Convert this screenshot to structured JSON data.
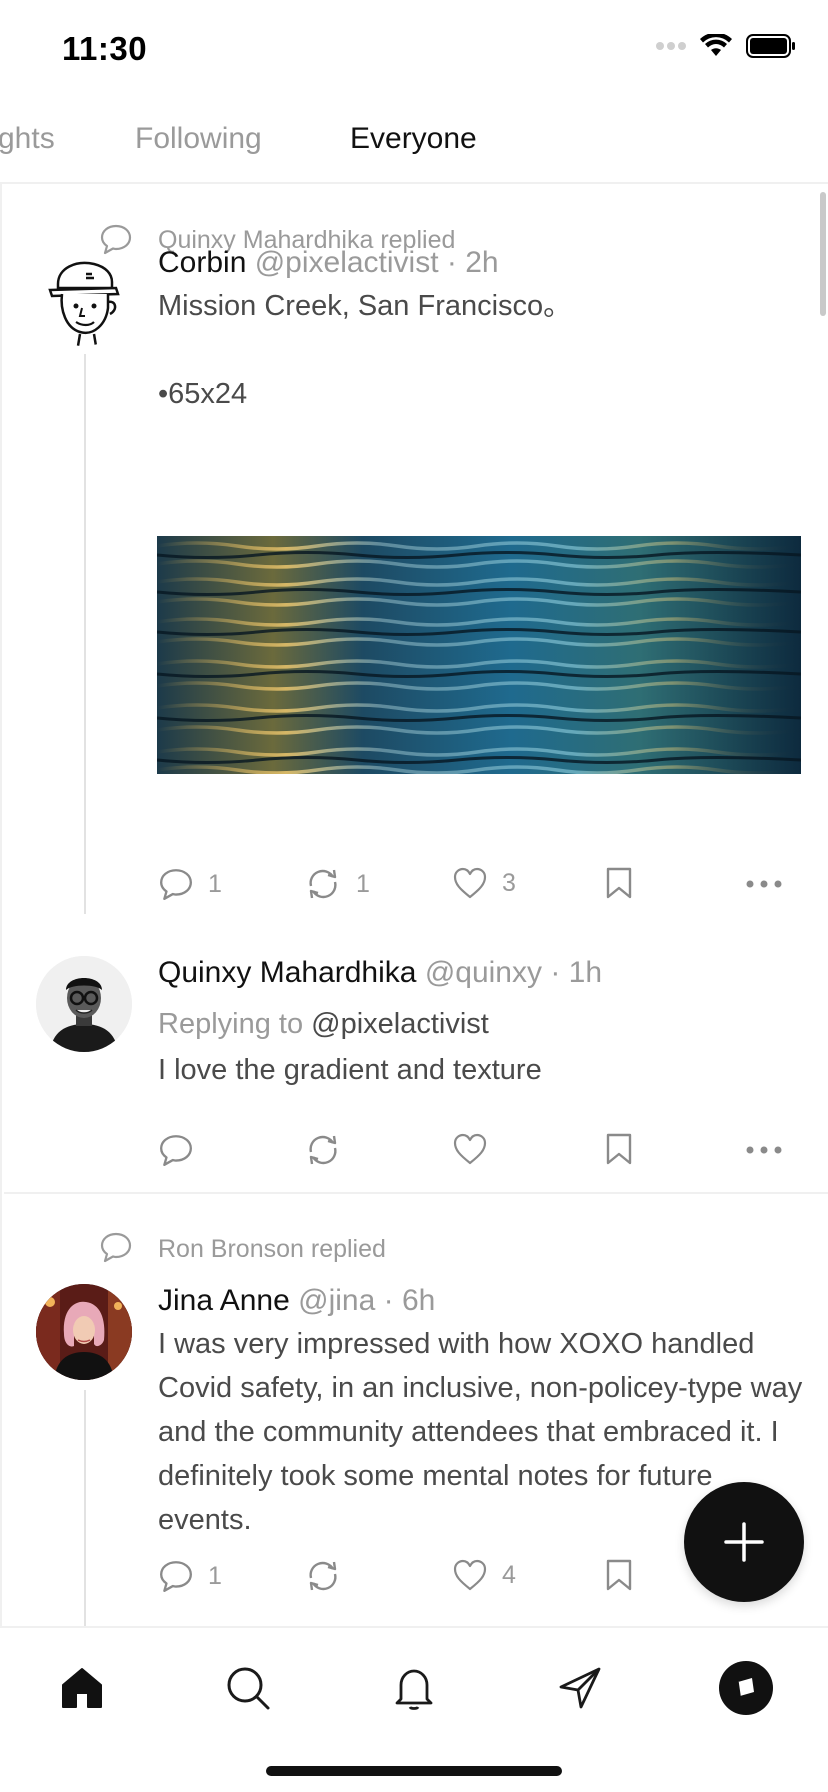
{
  "status": {
    "time": "11:30"
  },
  "tabs": [
    {
      "label": "ghts"
    },
    {
      "label": "Following"
    },
    {
      "label": "Everyone"
    }
  ],
  "feed": {
    "items": [
      {
        "reply_context": "Quinxy Mahardhika replied",
        "name": "Corbin",
        "handle": "@pixelactivist · 2h",
        "text_line1": "Mission Creek, San Francisco。",
        "text_line2": "•65x24",
        "actions": {
          "replies": "1",
          "reposts": "1",
          "likes": "3"
        }
      },
      {
        "name": "Quinxy Mahardhika",
        "handle": "@quinxy · 1h",
        "replying_label": "Replying to",
        "replying_mention": "@pixelactivist",
        "text": "I love the gradient and texture"
      },
      {
        "reply_context": "Ron Bronson replied",
        "name": "Jina Anne",
        "handle": "@jina · 6h",
        "text": "I was very impressed with how XOXO handled Covid safety, in an inclusive, non-policey-type way and the community attendees that embraced it. I definitely took some mental notes for future events.",
        "actions": {
          "replies": "1",
          "likes": "4"
        }
      }
    ]
  },
  "bottom_nav": [
    {
      "icon": "home-icon"
    },
    {
      "icon": "search-icon"
    },
    {
      "icon": "bell-icon"
    },
    {
      "icon": "send-icon"
    },
    {
      "icon": "profile-icon"
    }
  ],
  "colors": {
    "accent": "#111111",
    "muted": "#9a9a9a",
    "body_text": "#4a4a4a",
    "divider": "#f0f0f0"
  }
}
